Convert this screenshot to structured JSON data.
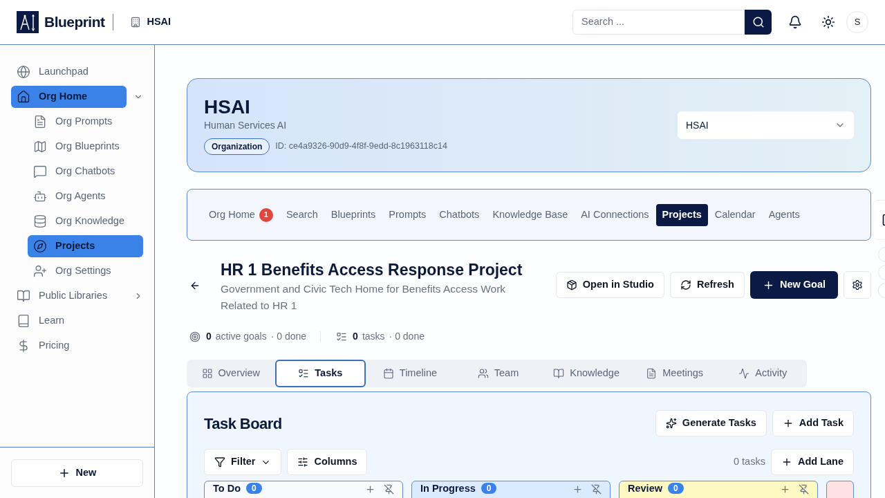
{
  "header": {
    "brand": "Blueprint",
    "org": "HSAI",
    "search_placeholder": "Search ...",
    "avatar": "S"
  },
  "sidebar": {
    "items": [
      {
        "label": "Launchpad",
        "selected": false
      },
      {
        "label": "Org Home",
        "selected": true,
        "expanded": true,
        "children": [
          {
            "label": "Org Prompts",
            "selected": false
          },
          {
            "label": "Org Blueprints",
            "selected": false
          },
          {
            "label": "Org Chatbots",
            "selected": false
          },
          {
            "label": "Org Agents",
            "selected": false
          },
          {
            "label": "Org Knowledge",
            "selected": false
          },
          {
            "label": "Projects",
            "selected": true
          },
          {
            "label": "Org Settings",
            "selected": false
          }
        ]
      },
      {
        "label": "Public Libraries",
        "selected": false,
        "expanded": false
      },
      {
        "label": "Learn",
        "selected": false
      },
      {
        "label": "Pricing",
        "selected": false
      }
    ],
    "new_button": "New"
  },
  "org_card": {
    "title": "HSAI",
    "subtitle": "Human Services AI",
    "badge": "Organization",
    "id": "ID: ce4a9326-90d9-4f8f-9edd-8c1963118c14",
    "select_value": "HSAI"
  },
  "org_tabs": [
    {
      "label": "Org Home",
      "badge": "1",
      "selected": false
    },
    {
      "label": "Search",
      "selected": false
    },
    {
      "label": "Blueprints",
      "selected": false
    },
    {
      "label": "Prompts",
      "selected": false
    },
    {
      "label": "Chatbots",
      "selected": false
    },
    {
      "label": "Knowledge Base",
      "selected": false
    },
    {
      "label": "AI Connections",
      "selected": false
    },
    {
      "label": "Projects",
      "selected": true
    },
    {
      "label": "Calendar",
      "selected": false
    },
    {
      "label": "Agents",
      "selected": false
    }
  ],
  "project": {
    "title": "HR 1 Benefits Access Response Project",
    "description": "Government and Civic Tech Home for Benefits Access Work Related to HR 1",
    "buttons": [
      "Open in Studio",
      "Refresh",
      "New Goal"
    ],
    "stats": {
      "goals_count": "0",
      "goals_label": "active goals",
      "goals_done": "· 0 done",
      "tasks_count": "0",
      "tasks_label": "tasks",
      "tasks_done": "· 0 done"
    }
  },
  "project_tabs": [
    {
      "label": "Overview",
      "selected": false
    },
    {
      "label": "Tasks",
      "selected": true
    },
    {
      "label": "Timeline",
      "selected": false
    },
    {
      "label": "Team",
      "selected": false
    },
    {
      "label": "Knowledge",
      "selected": false
    },
    {
      "label": "Meetings",
      "selected": false
    },
    {
      "label": "Activity",
      "selected": false
    }
  ],
  "task_board": {
    "title": "Task Board",
    "generate": "Generate Tasks",
    "add_task": "Add Task",
    "filter": "Filter",
    "columns": "Columns",
    "task_count": "0 tasks",
    "add_lane": "Add Lane",
    "lanes": [
      {
        "name": "To Do",
        "count": "0",
        "color": "#f8fafc"
      },
      {
        "name": "In Progress",
        "count": "0",
        "color": "#dbeafe"
      },
      {
        "name": "Review",
        "count": "0",
        "color": "#fef9c3"
      },
      {
        "color": "#fee2e2"
      }
    ]
  }
}
